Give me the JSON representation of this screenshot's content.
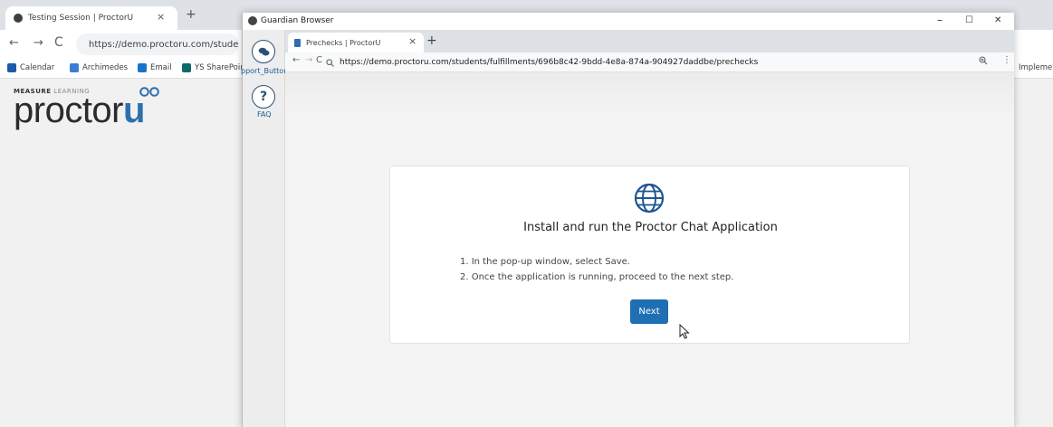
{
  "background_browser": {
    "tab_title": "Testing Session | ProctorU",
    "tab_close": "×",
    "new_tab": "+",
    "address": "https://demo.proctoru.com/students",
    "bookmarks": [
      {
        "label": "Calendar",
        "color": "#1e5aa8"
      },
      {
        "label": "Archimedes",
        "color": "#3b7bd4"
      },
      {
        "label": "Email",
        "color": "#1a73c8"
      },
      {
        "label": "YS SharePoin",
        "color": "#0d6a6a"
      }
    ],
    "bookmark_overflow": "Implemen",
    "logo": {
      "tagline_bold": "MEASURE",
      "tagline_light": "LEARNING",
      "brand_main": "proctor",
      "brand_accent": "u",
      "brand_color": "#2e6fae"
    }
  },
  "guardian": {
    "window_title": "Guardian Browser",
    "controls": {
      "minimize": "–",
      "maximize": "☐",
      "close": "✕"
    },
    "sidebar": {
      "support_label": "pport_Button",
      "faq_icon_text": "?",
      "faq_label": "FAQ"
    },
    "tab_title": "Prechecks | ProctorU",
    "tab_close": "×",
    "new_tab": "+",
    "url": "https://demo.proctoru.com/students/fulfillments/696b8c42-9bdd-4e8a-874a-904927daddbe/prechecks",
    "card": {
      "title": "Install and run the Proctor Chat Application",
      "steps": [
        "1. In the pop-up window, select Save.",
        "2. Once the application is running, proceed to the next step."
      ],
      "next_label": "Next",
      "accent": "#1f6fb5"
    }
  }
}
